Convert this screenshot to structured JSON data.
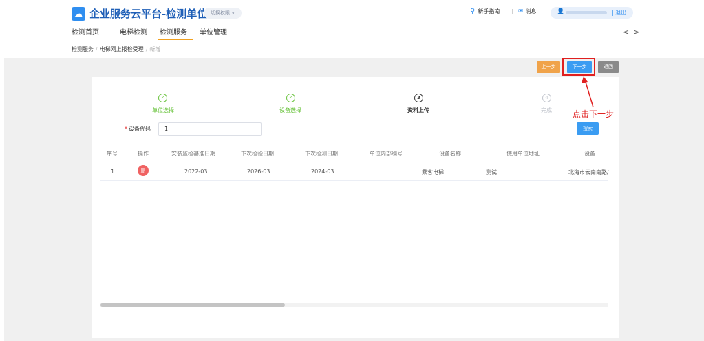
{
  "header": {
    "app_title": "企业服务云平台-检测单位",
    "switch_permission": "切换权限 ∨",
    "guide": "新手指南",
    "message": "消息",
    "logout": "| 退出"
  },
  "nav": {
    "items": [
      "检测首页",
      "电梯检测",
      "检测服务",
      "单位管理"
    ],
    "active_index": 2,
    "prev_arrow": "<",
    "next_arrow": ">"
  },
  "breadcrumb": {
    "items": [
      "检测服务",
      "电梯网上报检受理",
      "新增"
    ]
  },
  "actions": {
    "prev": "上一步",
    "next": "下一步",
    "back": "返回"
  },
  "steps": [
    {
      "label": "单位选择",
      "status": "done",
      "mark": "✓"
    },
    {
      "label": "设备选择",
      "status": "done",
      "mark": "✓"
    },
    {
      "label": "资料上传",
      "status": "current",
      "mark": "3"
    },
    {
      "label": "完成",
      "status": "pending",
      "mark": "4"
    }
  ],
  "annotation": {
    "text": "点击下一步"
  },
  "filter": {
    "label": "设备代码",
    "value": "1",
    "search_label": "搜索"
  },
  "table": {
    "headers": [
      "序号",
      "操作",
      "安装监检基准日期",
      "下次检验日期",
      "下次检测日期",
      "单位内部编号",
      "设备名称",
      "使用单位地址",
      "设备"
    ],
    "rows": [
      {
        "index": "1",
        "action_icon": "删",
        "install_date": "2022-03",
        "next_inspection": "2026-03",
        "next_test": "2024-03",
        "internal_no": "",
        "device_name": "乘客电梯",
        "extra": "测试",
        "address": "北海市云南南路/"
      }
    ]
  },
  "colors": {
    "brand": "#1f5fb7",
    "primary": "#3a9cf2",
    "warning": "#f0a34a",
    "success": "#67c23a",
    "danger": "#e02020"
  }
}
